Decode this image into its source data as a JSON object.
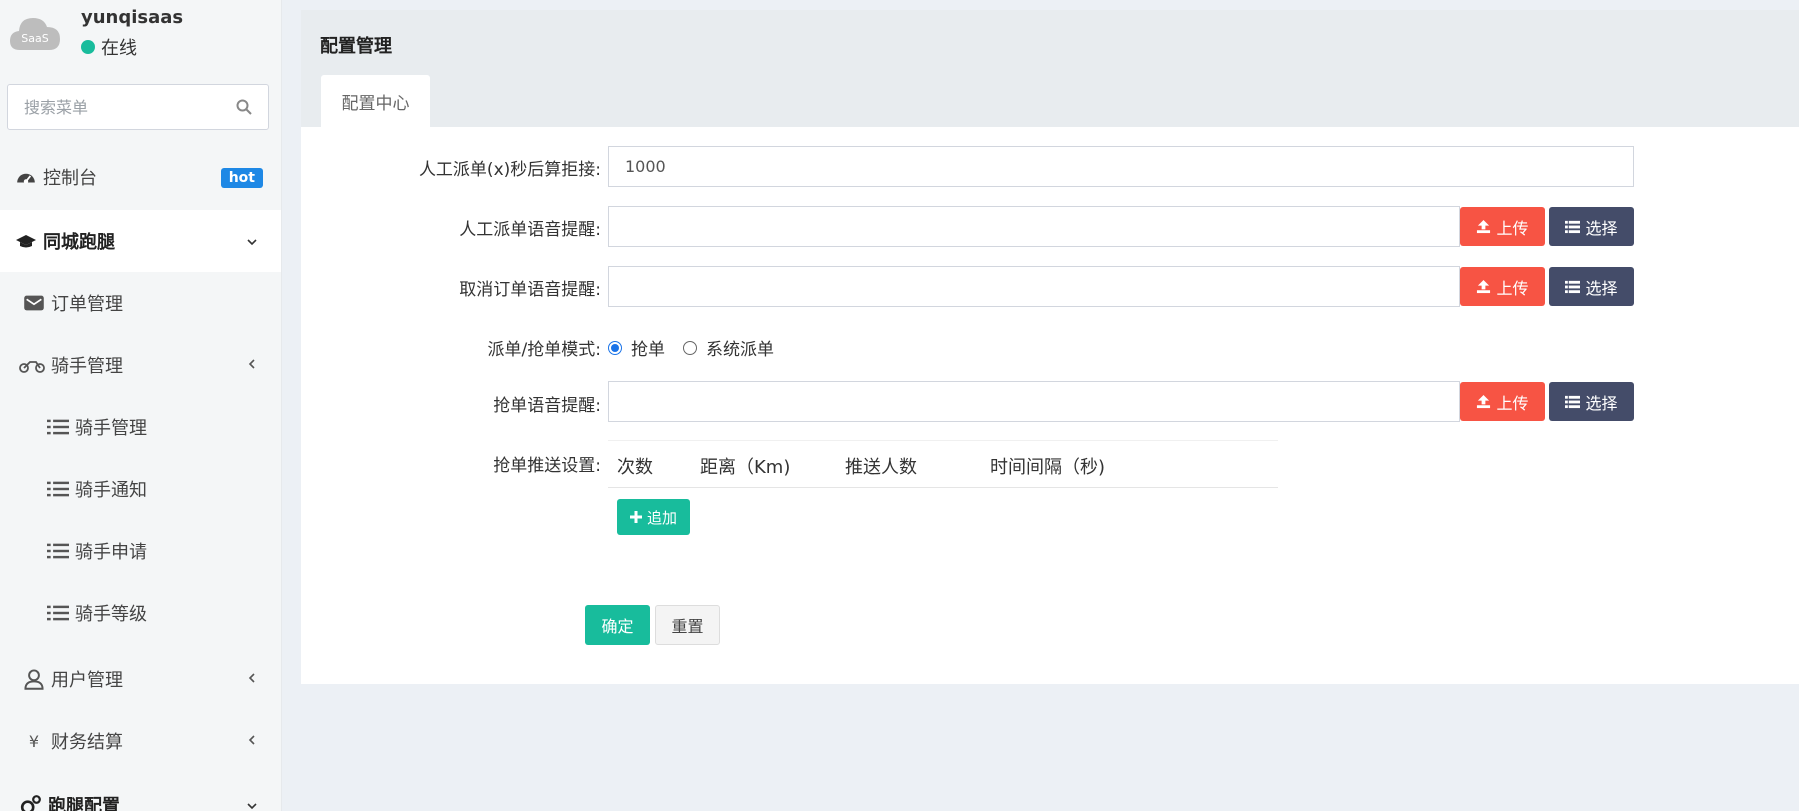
{
  "user": {
    "avatar_text": "SaaS",
    "name": "yunqisaas",
    "status": "在线"
  },
  "sidebar": {
    "search_placeholder": "搜索菜单",
    "items": [
      {
        "label": "控制台",
        "badge": "hot"
      },
      {
        "label": "同城跑腿"
      },
      {
        "label": "订单管理"
      },
      {
        "label": "骑手管理"
      },
      {
        "label": "骑手管理"
      },
      {
        "label": "骑手通知"
      },
      {
        "label": "骑手申请"
      },
      {
        "label": "骑手等级"
      },
      {
        "label": "用户管理"
      },
      {
        "label": "财务结算"
      },
      {
        "label": "跑腿配置"
      }
    ]
  },
  "panel": {
    "title": "配置管理",
    "tab": "配置中心"
  },
  "form": {
    "manual_reject": {
      "label": "人工派单(x)秒后算拒接:",
      "value": "1000"
    },
    "manual_voice": {
      "label": "人工派单语音提醒:"
    },
    "cancel_voice": {
      "label": "取消订单语音提醒:"
    },
    "mode": {
      "label": "派单/抢单模式:",
      "options": [
        "抢单",
        "系统派单"
      ],
      "selected": "抢单"
    },
    "grab_voice": {
      "label": "抢单语音提醒:"
    },
    "push": {
      "label": "抢单推送设置:",
      "columns": [
        "次数",
        "距离（Km)",
        "推送人数",
        "时间间隔（秒)"
      ],
      "add_label": "追加"
    },
    "upload_label": "上传",
    "select_label": "选择",
    "submit_label": "确定",
    "reset_label": "重置"
  },
  "colors": {
    "danger": "#f75444",
    "dark": "#444c69",
    "success": "#18bc9c",
    "badge": "#1e88e5"
  }
}
